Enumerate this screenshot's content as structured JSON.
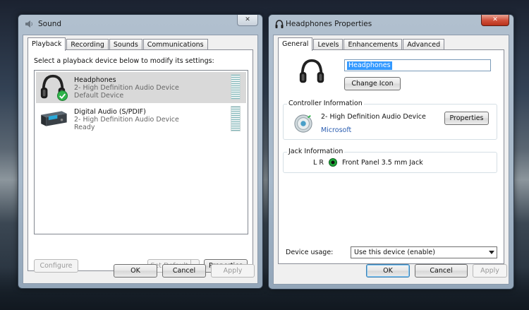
{
  "sound": {
    "title": "Sound",
    "close": "✕",
    "tabs": [
      "Playback",
      "Recording",
      "Sounds",
      "Communications"
    ],
    "instruction": "Select a playback device below to modify its settings:",
    "devices": [
      {
        "name": "Headphones",
        "line1": "2- High Definition Audio Device",
        "line2": "Default Device"
      },
      {
        "name": "Digital Audio (S/PDIF)",
        "line1": "2- High Definition Audio Device",
        "line2": "Ready"
      }
    ],
    "configure_label": "Configure",
    "set_default_label": "Set Default",
    "properties_label": "Properties",
    "ok_label": "OK",
    "cancel_label": "Cancel",
    "apply_label": "Apply"
  },
  "props": {
    "title": "Headphones Properties",
    "close": "✕",
    "tabs": [
      "General",
      "Levels",
      "Enhancements",
      "Advanced"
    ],
    "name_value": "Headphones",
    "change_icon_label": "Change Icon",
    "controller": {
      "legend": "Controller Information",
      "device": "2- High Definition Audio Device",
      "vendor": "Microsoft",
      "properties_label": "Properties"
    },
    "jack": {
      "legend": "Jack Information",
      "channels": "L R",
      "description": "Front Panel 3.5 mm Jack"
    },
    "usage_label": "Device usage:",
    "usage_value": "Use this device (enable)",
    "ok_label": "OK",
    "cancel_label": "Cancel",
    "apply_label": "Apply"
  },
  "colors": {
    "jack_green": "#1fa83a",
    "check_green": "#2fb34a",
    "selection": "#3399ff"
  }
}
